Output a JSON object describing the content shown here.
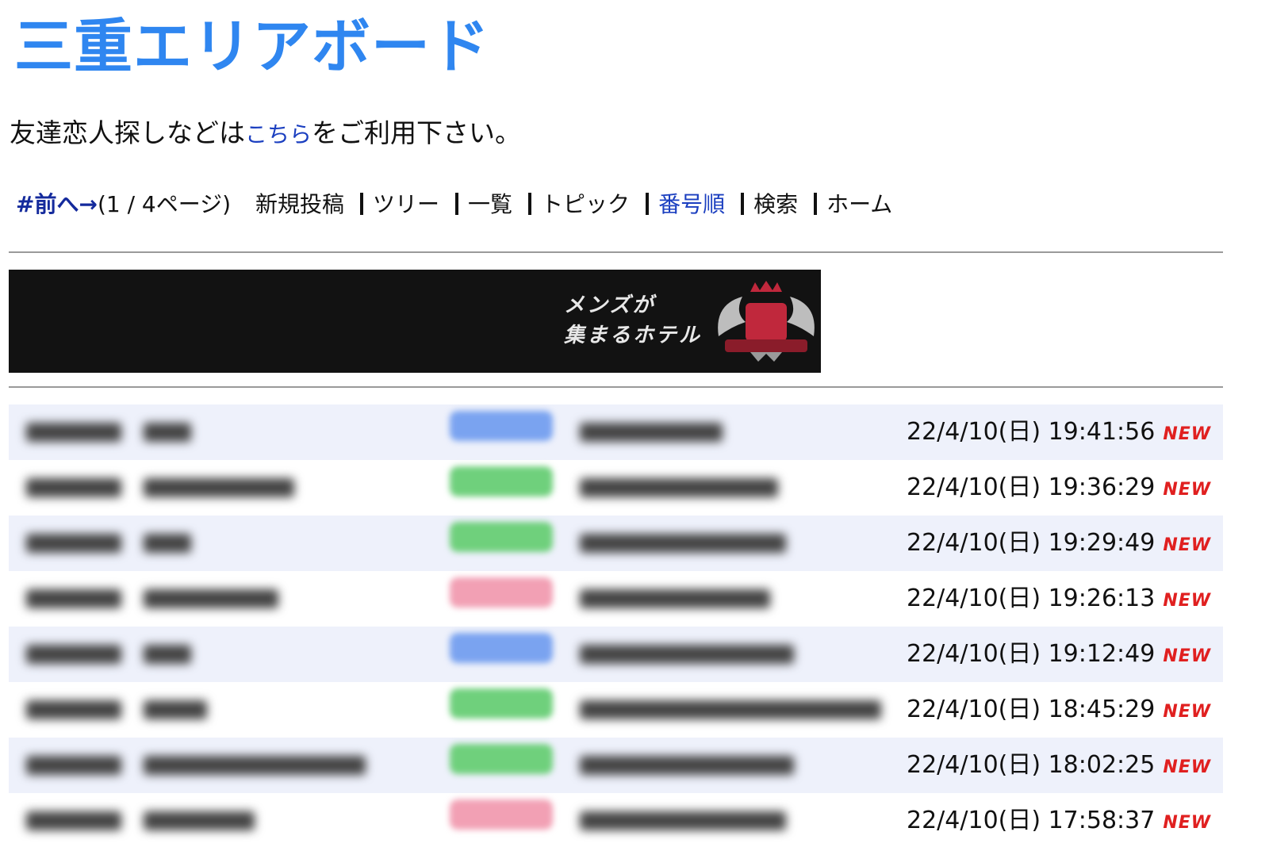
{
  "header": {
    "title": "三重エリアボード"
  },
  "intro": {
    "before": "友達恋人探しなどは",
    "link": "こちら",
    "after": "をご利用下さい。"
  },
  "nav": {
    "prev": "#前へ→",
    "page_info": "(1 / 4ページ)",
    "items": [
      "新規投稿",
      "ツリー",
      "一覧",
      "トピック",
      "番号順",
      "検索",
      "ホーム"
    ],
    "active_index": 4
  },
  "banner": {
    "line1": "メンズが",
    "line2": "集まるホテル",
    "logo": "crest-logo-icon"
  },
  "posts": [
    {
      "pill_color": "#7aa3f0",
      "date": "22/4/10(日) 19:41:56",
      "badge": "NEW"
    },
    {
      "pill_color": "#6fd07c",
      "date": "22/4/10(日) 19:36:29",
      "badge": "NEW"
    },
    {
      "pill_color": "#6fd07c",
      "date": "22/4/10(日) 19:29:49",
      "badge": "NEW"
    },
    {
      "pill_color": "#f2a0b4",
      "date": "22/4/10(日) 19:26:13",
      "badge": "NEW"
    },
    {
      "pill_color": "#7aa3f0",
      "date": "22/4/10(日) 19:12:49",
      "badge": "NEW"
    },
    {
      "pill_color": "#6fd07c",
      "date": "22/4/10(日) 18:45:29",
      "badge": "NEW"
    },
    {
      "pill_color": "#6fd07c",
      "date": "22/4/10(日) 18:02:25",
      "badge": "NEW"
    },
    {
      "pill_color": "#f2a0b4",
      "date": "22/4/10(日) 17:58:37",
      "badge": "NEW"
    }
  ],
  "colors": {
    "title": "#2f86f0",
    "link": "#1b3fc0",
    "new": "#e02020",
    "row_alt": "#eef1fb"
  }
}
